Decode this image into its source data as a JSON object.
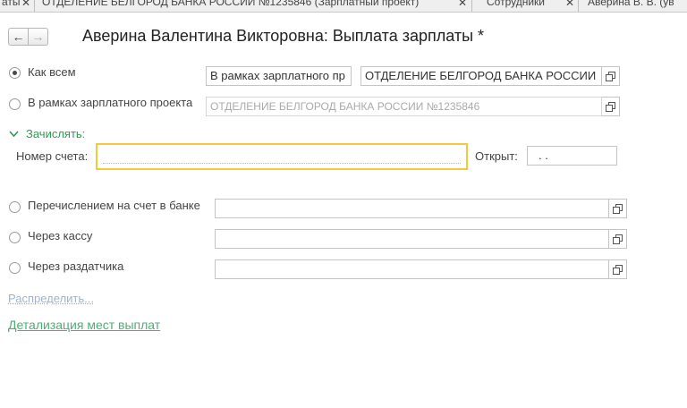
{
  "tabs": [
    {
      "label": "аты"
    },
    {
      "label": "ОТДЕЛЕНИЕ БЕЛГОРОД БАНКА РОССИИ №1235846 (Зарплатный проект)"
    },
    {
      "label": "Сотрудники"
    },
    {
      "label": "Аверина В. В. (ув"
    }
  ],
  "toolbar": {
    "back": "←",
    "forward": "→"
  },
  "title": "Аверина Валентина Викторовна: Выплата зарплаты *",
  "options": {
    "as_all": {
      "label": "Как всем",
      "field1": "В рамках зарплатного пр",
      "field2": "ОТДЕЛЕНИЕ БЕЛГОРОД БАНКА РОССИИ"
    },
    "payroll_project": {
      "label": "В рамках зарплатного проекта",
      "value": "ОТДЕЛЕНИЕ БЕЛГОРОД БАНКА РОССИИ №1235846"
    }
  },
  "credit": {
    "section_label": "Зачислять:",
    "account_label": "Номер счета:",
    "account_value": "",
    "opened_label": "Открыт:",
    "opened_value": " .  ."
  },
  "payments": [
    {
      "label": "Перечислением на счет в банке",
      "value": ""
    },
    {
      "label": "Через кассу",
      "value": ""
    },
    {
      "label": "Через раздатчика",
      "value": ""
    }
  ],
  "distribute_link": "Распределить...",
  "details_link": "Детализация мест выплат",
  "colors": {
    "accent_green": "#2f9a55",
    "focus_yellow": "#f3c83b"
  }
}
